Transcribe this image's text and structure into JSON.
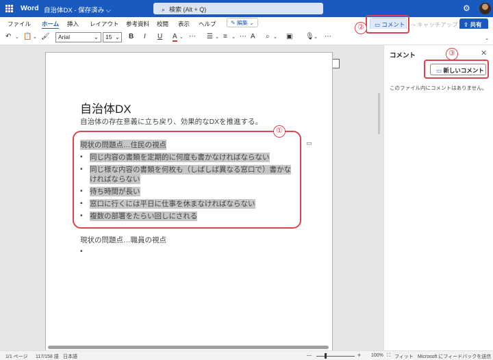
{
  "titlebar": {
    "app_name": "Word",
    "doc_title": "自治体DX - 保存済み ⌵",
    "search_placeholder": "検索 (Alt + Q)"
  },
  "menu": [
    "ファイル",
    "ホーム",
    "挿入",
    "レイアウト",
    "参考資料",
    "校閲",
    "表示",
    "ヘルプ"
  ],
  "active_menu": "ホーム",
  "edit_mode": "編集",
  "comment_button": "コメント",
  "catchup_button": "キャッチアップ",
  "share_button": "共有",
  "toolbar": {
    "font_name": "Arial",
    "font_size": "15"
  },
  "document": {
    "title": "自治体DX",
    "subtitle": "自治体の存在意義に立ち戻り、効果的なDXを推進する。",
    "section1_heading": "現状の問題点…住民の視点",
    "section1_bullets": [
      "同じ内容の書類を定期的に何度も書かなければならない",
      "同じ様な内容の書類を何枚も（しばしば異なる窓口で）書かな",
      "ければならない",
      "待ち時間が長い",
      "窓口に行くには平日に仕事を休まなければならない",
      "複数の部署をたらい回しにされる"
    ],
    "section2_heading": "現状の問題点…職員の視点",
    "bullet_char": "•"
  },
  "comments_panel": {
    "title": "コメント",
    "new_comment_button": "新しいコメント",
    "empty_message": "このファイル内にコメントはありません。"
  },
  "annotations": {
    "one": "①",
    "two": "②",
    "three": "③"
  },
  "statusbar": {
    "page": "1/1 ページ",
    "words": "117/158 語",
    "language": "日本語",
    "zoom_minus": "—",
    "zoom_plus": "+",
    "zoom": "100%",
    "fit": "フィット",
    "feedback": "Microsoft にフィードバックを送信"
  },
  "colors": {
    "brand": "#185abd",
    "annotation": "#d8434d",
    "highlight": "#c8c6c4"
  }
}
